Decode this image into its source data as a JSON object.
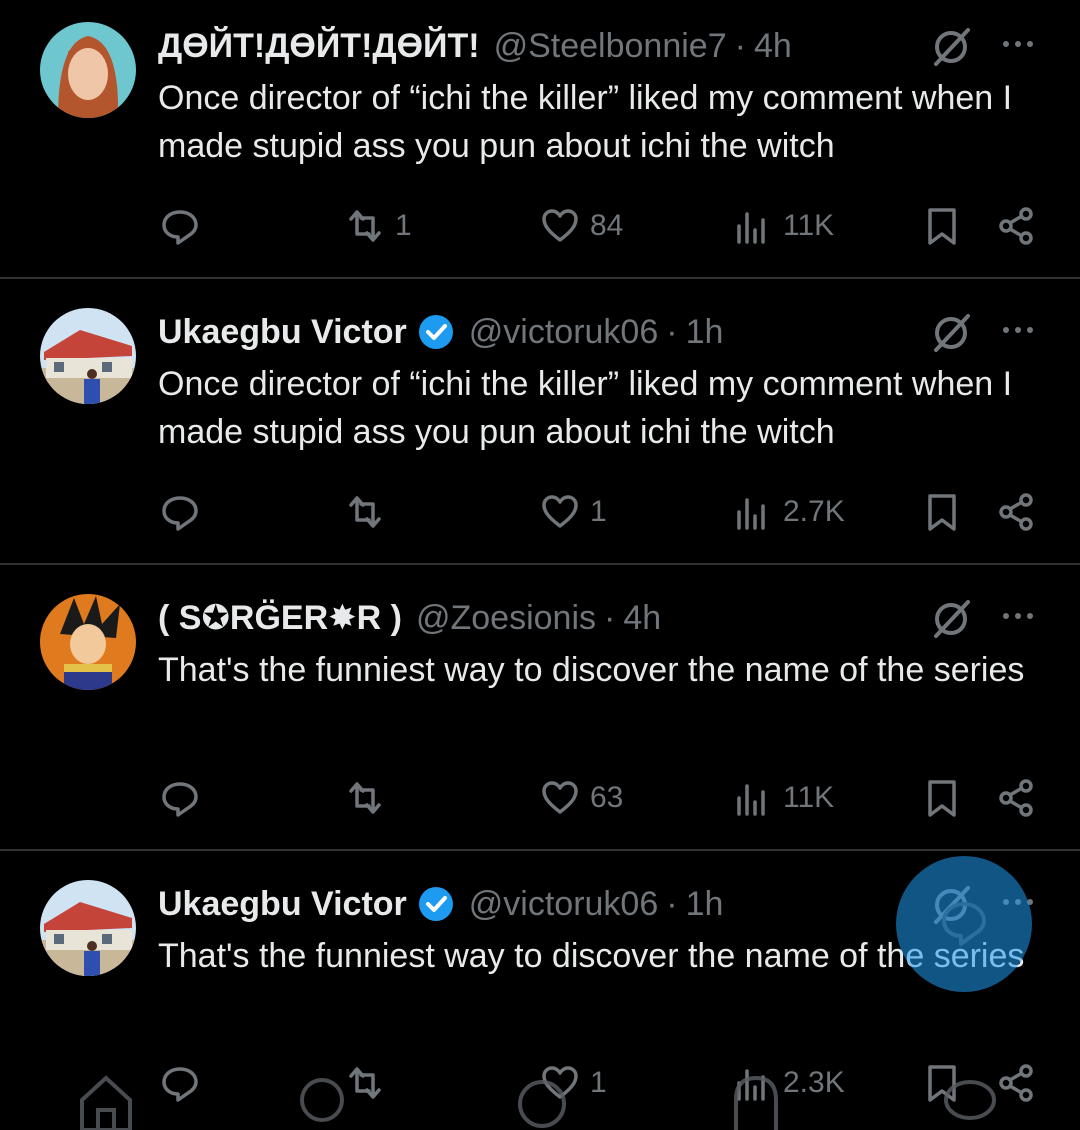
{
  "tweets": [
    {
      "name": "ДӨЙТ!ДӨЙТ!ДӨЙТ!",
      "verified": false,
      "handle": "@Steelbonnie7",
      "time": "4h",
      "text": "Once director of “ichi the killer” liked my comment when I made stupid ass you pun about ichi the witch",
      "replies": "",
      "reposts": "1",
      "likes": "84",
      "views": "11K",
      "avatar": "anime-girl-avatar"
    },
    {
      "name": "Ukaegbu Victor",
      "verified": true,
      "handle": "@victoruk06",
      "time": "1h",
      "text": "Once director of “ichi the killer” liked my comment when I made stupid ass you pun about ichi the witch",
      "replies": "",
      "reposts": "",
      "likes": "1",
      "views": "2.7K",
      "avatar": "house-photo-avatar"
    },
    {
      "name": "( S✪RG̈ER✸R )",
      "verified": false,
      "handle": "@Zoesionis",
      "time": "4h",
      "text": "That's the funniest way to discover the name of the series",
      "replies": "",
      "reposts": "",
      "likes": "63",
      "views": "11K",
      "avatar": "anime-saiyan-avatar"
    },
    {
      "name": "Ukaegbu Victor",
      "verified": true,
      "handle": "@victoruk06",
      "time": "1h",
      "text": "That's the funniest way to discover the name of the series",
      "replies": "",
      "reposts": "",
      "likes": "1",
      "views": "2.3K",
      "avatar": "house-photo-avatar"
    }
  ],
  "dot_separator": "·",
  "colors": {
    "background": "#000000",
    "text": "#e7e9ea",
    "secondary": "#71767b",
    "accent": "#1d9bf0",
    "divider": "#2f3336"
  },
  "icons": [
    "reply-icon",
    "repost-icon",
    "like-icon",
    "views-icon",
    "bookmark-icon",
    "share-icon",
    "grok-icon",
    "more-icon",
    "verified-badge-icon",
    "compose-reply-icon",
    "home-icon",
    "search-icon",
    "notifications-icon"
  ]
}
